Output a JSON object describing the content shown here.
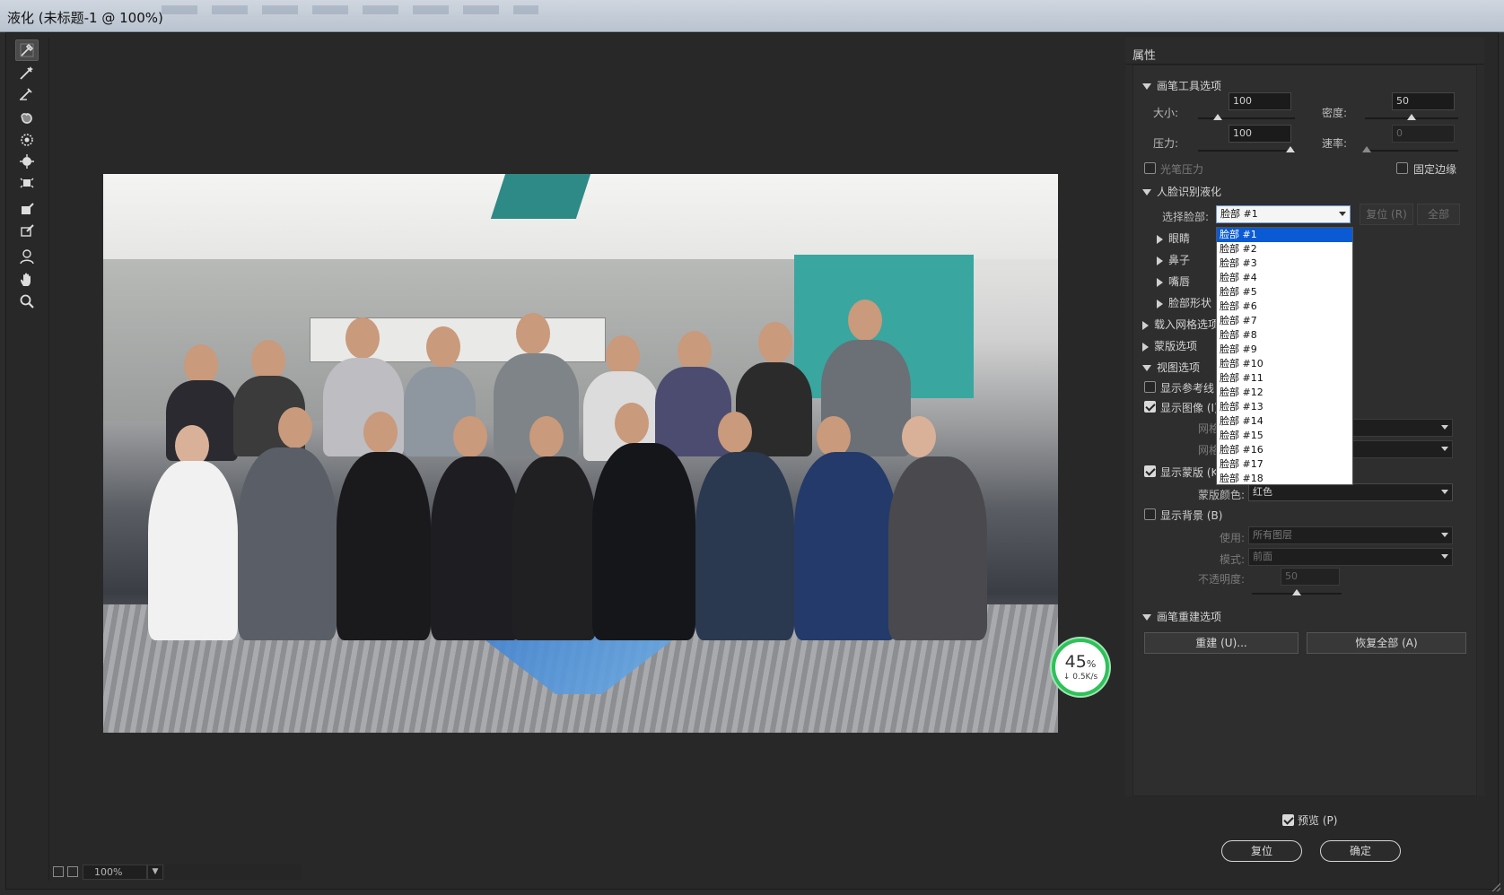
{
  "window": {
    "title": "液化 (未标题-1 @ 100%)"
  },
  "toolbar": {
    "tools": [
      {
        "name": "forward-warp-tool-icon"
      },
      {
        "name": "reconstruct-tool-icon"
      },
      {
        "name": "smooth-tool-icon"
      },
      {
        "name": "twirl-tool-icon"
      },
      {
        "name": "pucker-tool-icon"
      },
      {
        "name": "bloat-tool-icon"
      },
      {
        "name": "push-left-tool-icon"
      },
      {
        "name": "freeze-mask-tool-icon"
      },
      {
        "name": "thaw-mask-tool-icon"
      },
      {
        "name": "face-tool-icon"
      },
      {
        "name": "hand-tool-icon"
      },
      {
        "name": "zoom-tool-icon"
      }
    ]
  },
  "status": {
    "zoom": "100%"
  },
  "network_widget": {
    "percent": "45",
    "percent_sign": "%",
    "speed": "↓ 0.5K/s"
  },
  "panel": {
    "header": "属性",
    "brush_tool_options": {
      "title": "画笔工具选项",
      "size_label": "大小:",
      "size_value": "100",
      "size_level": 0.02,
      "density_label": "密度:",
      "density_value": "50",
      "density_level": 0.5,
      "pressure_label": "压力:",
      "pressure_value": "100",
      "pressure_level": 1.0,
      "rate_label": "速率:",
      "rate_value": "0",
      "rate_level": 0.0,
      "stylus_pressure_label": "光笔压力",
      "pin_edges_label": "固定边缘"
    },
    "face_aware": {
      "title": "人脸识别液化",
      "select_face_label": "选择脸部:",
      "select_face_value": "脸部 #1",
      "reset_button": "复位 (R)",
      "all_button": "全部",
      "sub_sections": [
        "眼睛",
        "鼻子",
        "嘴唇",
        "脸部形状"
      ],
      "options": [
        "脸部 #1",
        "脸部 #2",
        "脸部 #3",
        "脸部 #4",
        "脸部 #5",
        "脸部 #6",
        "脸部 #7",
        "脸部 #8",
        "脸部 #9",
        "脸部 #10",
        "脸部 #11",
        "脸部 #12",
        "脸部 #13",
        "脸部 #14",
        "脸部 #15",
        "脸部 #16",
        "脸部 #17",
        "脸部 #18"
      ]
    },
    "load_mesh_options": {
      "title": "载入网格选项"
    },
    "mask_options": {
      "title": "蒙版选项"
    },
    "view_options": {
      "title": "视图选项",
      "show_guides_label": "显示参考线",
      "show_image_label": "显示图像 (I)",
      "mesh_size_label": "网格",
      "mesh_color_label": "网格",
      "show_mask_label": "显示蒙版 (K)",
      "mask_color_label": "蒙版颜色:",
      "mask_color_value": "红色",
      "show_backdrop_label": "显示背景 (B)",
      "use_label": "使用:",
      "use_value": "所有图层",
      "mode_label": "模式:",
      "mode_value": "前面",
      "opacity_label": "不透明度:",
      "opacity_value": "50",
      "opacity_level": 0.5
    },
    "brush_reconstruct_options": {
      "title": "画笔重建选项",
      "reconstruct_button": "重建 (U)...",
      "restore_all_button": "恢复全部 (A)"
    },
    "footer": {
      "preview_label": "预览 (P)",
      "reset_button": "复位",
      "ok_button": "确定"
    }
  }
}
